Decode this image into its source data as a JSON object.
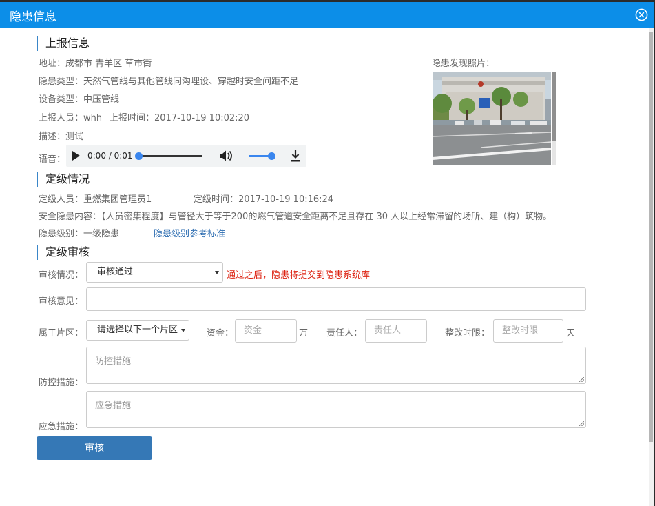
{
  "dialog": {
    "title": "隐患信息"
  },
  "report": {
    "section_title": "上报信息",
    "address": "地址：成都市 青羊区 草市街",
    "hazard_type": "隐患类型：天然气管线与其他管线同沟埋设、穿越时安全间距不足",
    "device_type": "设备类型：中压管线",
    "reporter": "上报人员：whh",
    "report_time": "上报时间：2017-10-19 10:02:20",
    "description": "描述：测试",
    "audio_label": "语音：",
    "audio_time": "0:00 / 0:01",
    "audio_progress": 0,
    "audio_volume": 1,
    "photo_label": "隐患发现照片："
  },
  "rating": {
    "section_title": "定级情况",
    "rater": "定级人员：重燃集团管理员1",
    "rating_time": "定级时间：2017-10-19 10:16:24",
    "content": "安全隐患内容：【人员密集程度】与管径大于等于200的燃气管道安全距离不足且存在 30 人以上经常滞留的场所、建（构）筑物。",
    "level": "隐患级别：一级隐患",
    "level_link": "隐患级别参考标准"
  },
  "review": {
    "section_title": "定级审核",
    "status_label": "审核情况：",
    "status_value": "审核通过",
    "status_note": "通过之后，隐患将提交到隐患系统库",
    "opinion_label": "审核意见：",
    "area_label": "属于片区：",
    "area_value": "请选择以下一个片区",
    "fund_label": "资金：",
    "fund_placeholder": "资金",
    "fund_unit": "万",
    "owner_label": "责任人：",
    "owner_placeholder": "责任人",
    "deadline_label": "整改时限：",
    "deadline_placeholder": "整改时限",
    "deadline_unit": "天",
    "control_label": "防控措施：",
    "control_placeholder": "防控措施",
    "emergency_label": "应急措施：",
    "emergency_placeholder": "应急措施",
    "submit_label": "审核"
  },
  "colors": {
    "titlebar": "#0c8ee8",
    "accent": "#3a86c8",
    "button": "#3578b6",
    "warning": "#dd2211",
    "link": "#2a6bb0"
  }
}
